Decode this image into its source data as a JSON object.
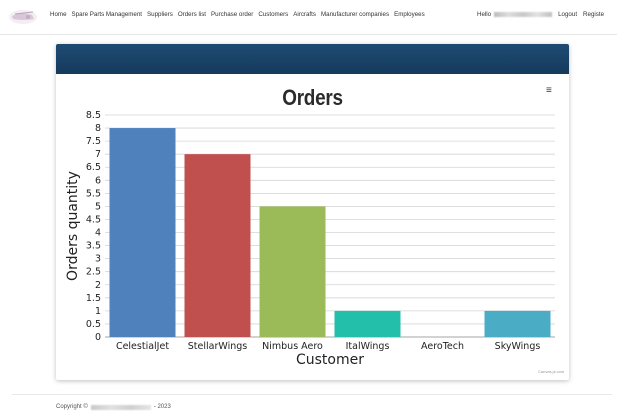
{
  "nav": {
    "items": [
      "Home",
      "Spare Parts Management",
      "Suppliers",
      "Orders list",
      "Purchase order",
      "Customers",
      "Aircrafts",
      "Manufacturer companies",
      "Employees"
    ],
    "hello": "Hello",
    "logout": "Logout",
    "register": "Registe"
  },
  "card": {
    "menu_icon": "≡",
    "credit": "Canvas.js.com"
  },
  "footer": {
    "copyright": "Copyright ©",
    "year": "- 2023"
  },
  "colors": {
    "header": "#1f4b73",
    "footer_divider": "#e8e8e8"
  },
  "icons": {
    "logo": "helicopter-logo",
    "menu": "hamburger-menu-icon"
  },
  "chart_data": {
    "type": "bar",
    "title": "Orders",
    "xlabel": "Customer",
    "ylabel": "Orders quantity",
    "categories": [
      "CelestialJet",
      "StellarWings",
      "Nimbus Aero",
      "ItalWings",
      "AeroTech",
      "SkyWings"
    ],
    "values": [
      8,
      7,
      5,
      1,
      0,
      1
    ],
    "colors": [
      "#4f81bd",
      "#c0504d",
      "#9bbb59",
      "#23bfaa",
      "#8064a2",
      "#4aacc5"
    ],
    "ylim": [
      0,
      8.5
    ],
    "ytick_step": 0.5,
    "yticks": [
      "0",
      "0.5",
      "1",
      "1.5",
      "2",
      "2.5",
      "3",
      "3.5",
      "4",
      "4.5",
      "5",
      "5.5",
      "6",
      "6.5",
      "7",
      "7.5",
      "8",
      "8.5"
    ],
    "grid": true,
    "legend": "none"
  }
}
